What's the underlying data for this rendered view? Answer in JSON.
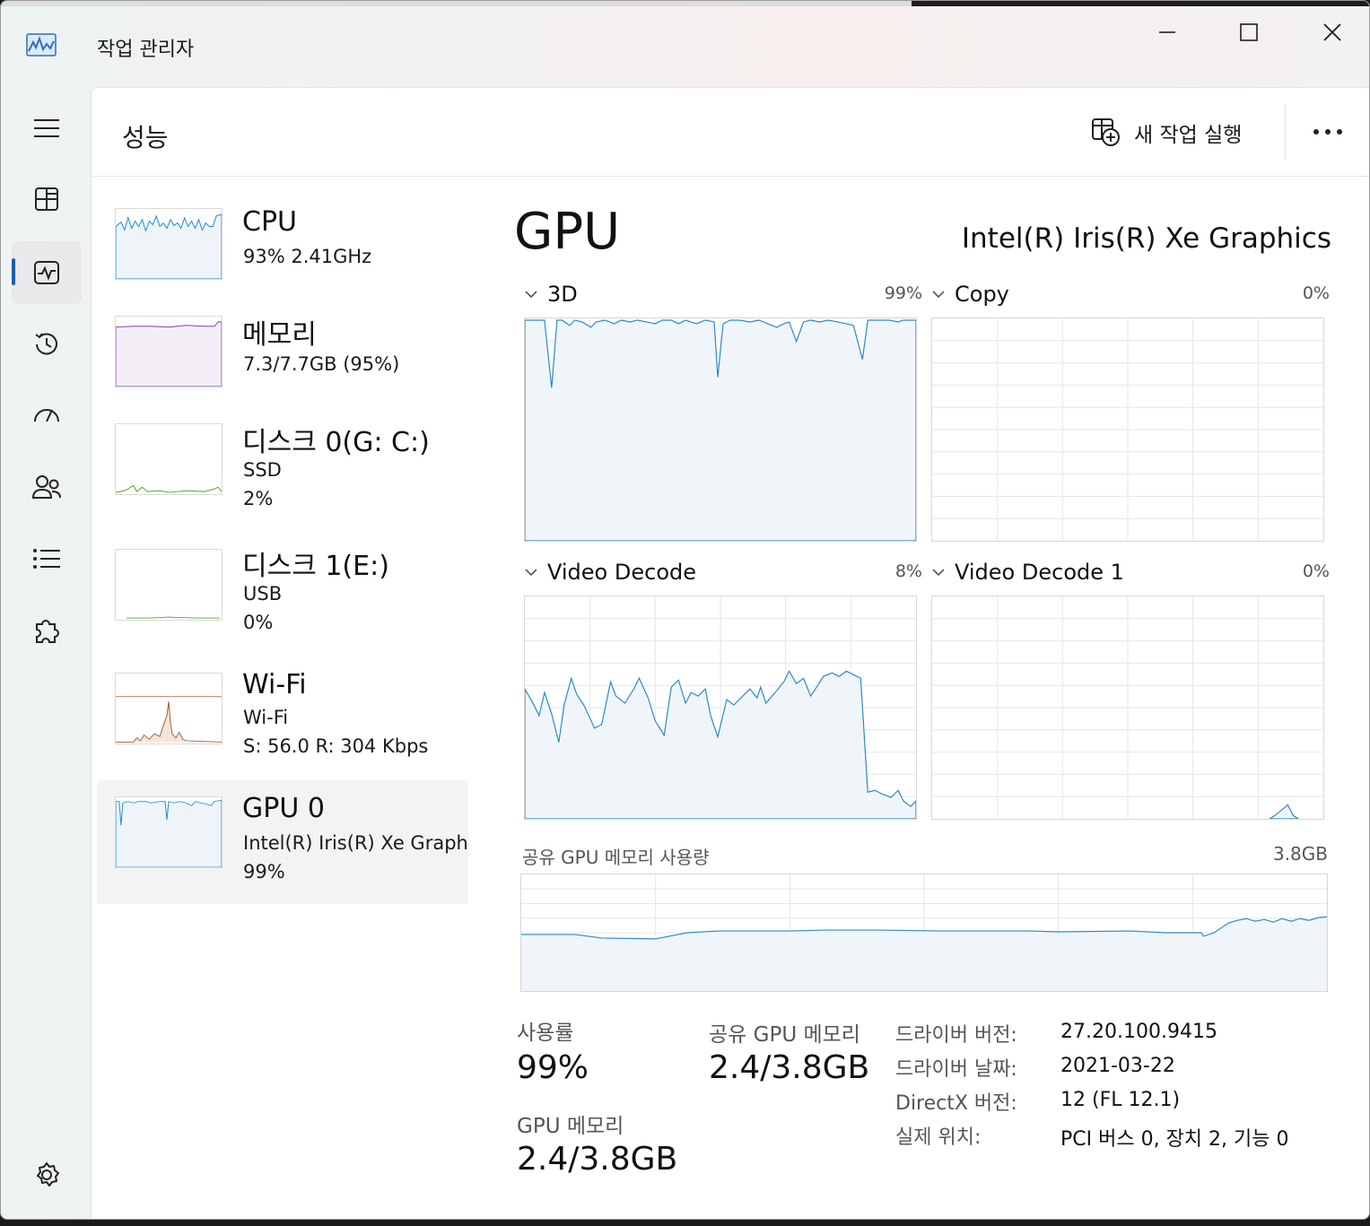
{
  "app": {
    "title": "작업 관리자"
  },
  "header": {
    "title": "성능",
    "new_task_label": "새 작업 실행"
  },
  "nav": [
    "hamburger-menu",
    "processes",
    "performance",
    "app-history",
    "startup-apps",
    "users",
    "details",
    "services",
    "settings"
  ],
  "side_list": [
    {
      "name": "CPU",
      "line1": "93%  2.41GHz",
      "line2": "",
      "color": "#1f8ad2"
    },
    {
      "name": "메모리",
      "line1": "7.3/7.7GB (95%)",
      "line2": "",
      "color": "#8e3ab8"
    },
    {
      "name": "디스크 0(G: C:)",
      "line1": "SSD",
      "line2": "2%",
      "color": "#4ea72e"
    },
    {
      "name": "디스크 1(E:)",
      "line1": "USB",
      "line2": "0%",
      "color": "#4ea72e"
    },
    {
      "name": "Wi-Fi",
      "line1": "Wi-Fi",
      "line2": "S: 56.0  R: 304 Kbps",
      "color": "#a7582b"
    },
    {
      "name": "GPU 0",
      "line1": "Intel(R) Iris(R) Xe Graphics",
      "line2": "99%",
      "color": "#1f8ad2"
    }
  ],
  "main": {
    "title": "GPU",
    "model": "Intel(R) Iris(R) Xe Graphics",
    "engines": [
      {
        "label": "3D",
        "percent": "99%"
      },
      {
        "label": "Copy",
        "percent": "0%"
      },
      {
        "label": "Video Decode",
        "percent": "8%"
      },
      {
        "label": "Video Decode 1",
        "percent": "0%"
      }
    ],
    "shared_mem_label": "공유 GPU 메모리 사용량",
    "shared_mem_max": "3.8GB",
    "stats": {
      "utilization_label": "사용률",
      "utilization_value": "99%",
      "shared_gpu_mem_label": "공유 GPU 메모리",
      "shared_gpu_mem_value": "2.4/3.8GB",
      "gpu_mem_label": "GPU 메모리",
      "gpu_mem_value": "2.4/3.8GB"
    },
    "properties": [
      {
        "label": "드라이버 버전:",
        "value": "27.20.100.9415"
      },
      {
        "label": "드라이버 날짜:",
        "value": "2021-03-22"
      },
      {
        "label": "DirectX 버전:",
        "value": "12 (FL 12.1)"
      },
      {
        "label": "실제 위치:",
        "value": "PCI 버스 0, 장치 2, 기능 0"
      }
    ]
  },
  "colors": {
    "accent": "#1f5ea8",
    "graph_line": "#2a8bc4",
    "graph_fill": "#f0f5f9",
    "grid": "#e6e6e6"
  }
}
